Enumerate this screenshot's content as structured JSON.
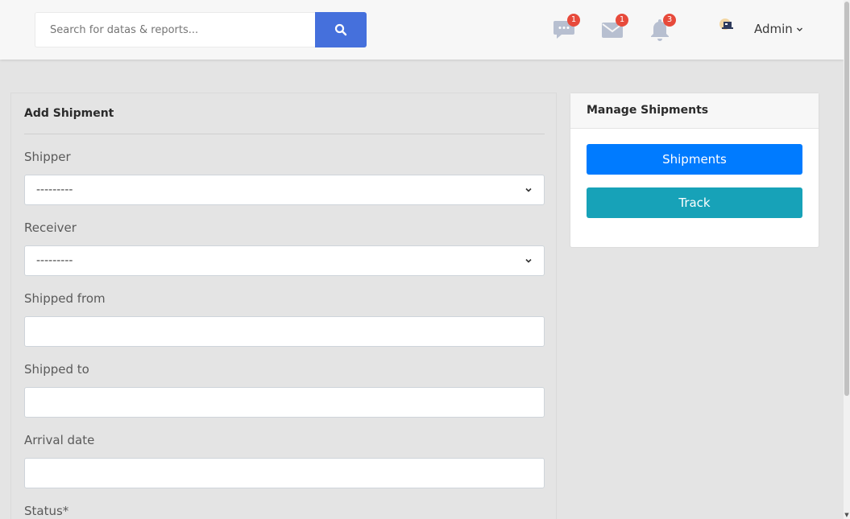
{
  "header": {
    "search": {
      "placeholder": "Search for datas & reports...",
      "value": ""
    },
    "search_icon": "search-icon",
    "notifications": [
      {
        "icon": "chat-icon",
        "count": "1"
      },
      {
        "icon": "envelope-icon",
        "count": "1"
      },
      {
        "icon": "bell-icon",
        "count": "3"
      }
    ],
    "user": {
      "name": "Admin"
    }
  },
  "form": {
    "title": "Add Shipment",
    "fields": [
      {
        "label": "Shipper",
        "value": "---------"
      },
      {
        "label": "Receiver",
        "value": "---------"
      },
      {
        "label": "Shipped from",
        "value": ""
      },
      {
        "label": "Shipped to",
        "value": ""
      },
      {
        "label": "Arrival date",
        "value": ""
      },
      {
        "label": "Status*"
      }
    ]
  },
  "side": {
    "title": "Manage Shipments",
    "buttons": [
      {
        "label": "Shipments",
        "color": "#007bff"
      },
      {
        "label": "Track",
        "color": "#17a2b8"
      }
    ]
  },
  "colors": {
    "search_button": "#4570dc",
    "badge": "#e74a3b",
    "topbar": "#f7f7f7",
    "page": "#e4e4e4"
  }
}
